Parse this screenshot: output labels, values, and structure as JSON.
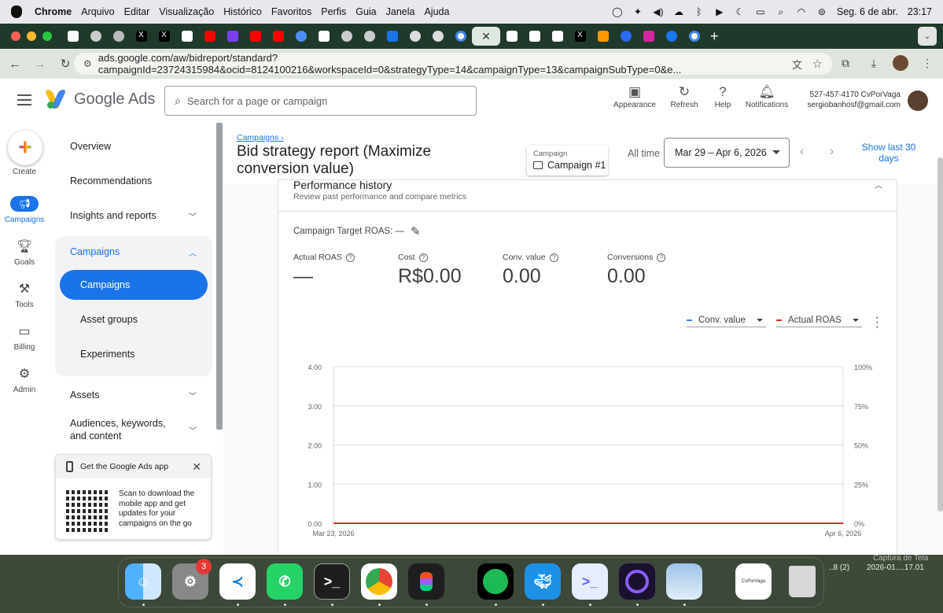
{
  "menubar": {
    "app": "Chrome",
    "items": [
      "Arquivo",
      "Editar",
      "Visualização",
      "Histórico",
      "Favoritos",
      "Perfis",
      "Guia",
      "Janela",
      "Ajuda"
    ],
    "date": "Seg. 6 de abr.",
    "time": "23:17"
  },
  "browser": {
    "url": "ads.google.com/aw/bidreport/standard?campaignId=23724315984&ocid=8124100216&workspaceId=0&strategyType=14&campaignType=13&campaignSubType=0&e..."
  },
  "header": {
    "logo_text": "Google Ads",
    "search_placeholder": "Search for a page or campaign",
    "actions": [
      "Appearance",
      "Refresh",
      "Help",
      "Notifications"
    ],
    "account_id": "527-457-4170 CvPorVaga",
    "account_email": "sergiobanhosf@gmail.com"
  },
  "rail": {
    "create": "Create",
    "campaigns": "Campaigns",
    "goals": "Goals",
    "tools": "Tools",
    "billing": "Billing",
    "admin": "Admin"
  },
  "sidenav": {
    "overview": "Overview",
    "recommendations": "Recommendations",
    "insights": "Insights and reports",
    "campaigns_group": "Campaigns",
    "campaigns": "Campaigns",
    "asset_groups": "Asset groups",
    "experiments": "Experiments",
    "assets": "Assets",
    "audiences": "Audiences, keywords, and content"
  },
  "app_card": {
    "title": "Get the Google Ads app",
    "desc": "Scan to download the mobile app and get updates for your campaigns on the go"
  },
  "page": {
    "breadcrumb": "Campaigns",
    "title": "Bid strategy report (Maximize conversion value)",
    "campaign_label": "Campaign",
    "campaign_value": "Campaign #1",
    "all_time": "All time",
    "date_range": "Mar 29 – Apr 6, 2026",
    "show_last": "Show last 30 days"
  },
  "performance": {
    "heading": "Performance history",
    "desc": "Review past performance and compare metrics",
    "target_roas": "Campaign Target ROAS: —",
    "metrics": [
      {
        "label": "Actual ROAS",
        "value": "—"
      },
      {
        "label": "Cost",
        "value": "R$0.00"
      },
      {
        "label": "Conv. value",
        "value": "0.00"
      },
      {
        "label": "Conversions",
        "value": "0.00"
      }
    ],
    "legend": [
      {
        "label": "Conv. value",
        "color": "#4285f4"
      },
      {
        "label": "Actual ROAS",
        "color": "#d93025"
      }
    ]
  },
  "chart_data": {
    "type": "line",
    "x": [
      "Mar 23, 2026",
      "Apr 6, 2026"
    ],
    "series": [
      {
        "name": "Conv. value",
        "values": [
          0,
          0
        ]
      },
      {
        "name": "Actual ROAS",
        "values": [
          0,
          0
        ]
      }
    ],
    "y_left_ticks": [
      "4.00",
      "3.00",
      "2.00",
      "1.00",
      "0.00"
    ],
    "y_right_ticks": [
      "100%",
      "75%",
      "50%",
      "25%",
      "0%"
    ],
    "x_ticks": [
      "Mar 23, 2026",
      "Apr 6, 2026"
    ],
    "ylim": [
      0,
      4
    ],
    "grid": true
  },
  "desktop": {
    "dock_badge": "3",
    "label1": "..8 (2)",
    "label2": "2026-01....17.01",
    "label3": "Captura de Tela",
    "thumb_text": "CvPorVaga"
  }
}
